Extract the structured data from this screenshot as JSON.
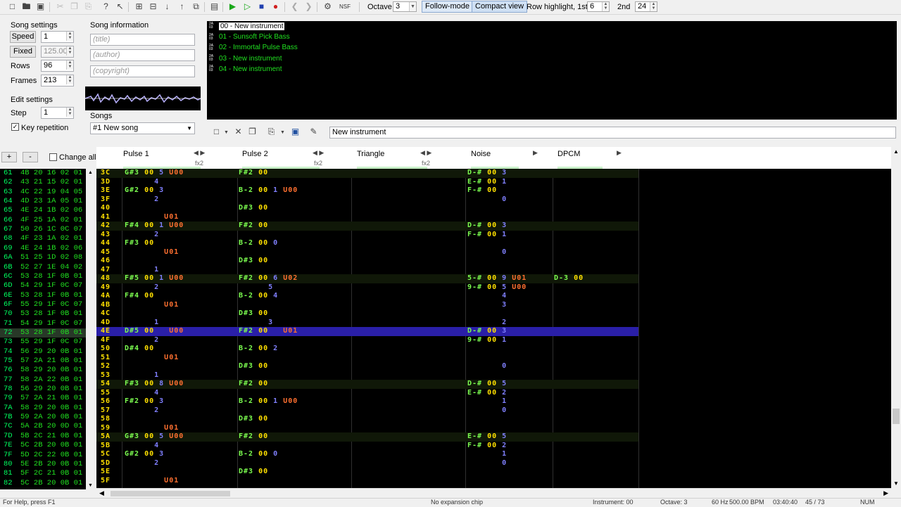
{
  "toolbar": {
    "octave_label": "Octave",
    "octave_value": "3",
    "follow_mode": "Follow-mode",
    "compact_view": "Compact view",
    "row_highlight_label": "Row highlight, 1st",
    "row_highlight_1st": "6",
    "second_label": "2nd",
    "row_highlight_2nd": "24"
  },
  "song_settings": {
    "title": "Song settings",
    "speed_label": "Speed",
    "speed_value": "1",
    "fixed_label": "Fixed",
    "tempo_value": "125.00",
    "rows_label": "Rows",
    "rows_value": "96",
    "frames_label": "Frames",
    "frames_value": "213"
  },
  "song_info": {
    "title": "Song information",
    "title_placeholder": "(title)",
    "author_placeholder": "(author)",
    "copyright_placeholder": "(copyright)"
  },
  "edit_settings": {
    "title": "Edit settings",
    "step_label": "Step",
    "step_value": "1",
    "key_repetition": "Key repetition"
  },
  "songs": {
    "label": "Songs",
    "selected": "#1 New song"
  },
  "instruments": [
    {
      "label": "00 - New instrument",
      "selected": true
    },
    {
      "label": "01 - Sunsoft Pick Bass",
      "selected": false
    },
    {
      "label": "02 - Immortal Pulse Bass",
      "selected": false
    },
    {
      "label": "03 - New instrument",
      "selected": false
    },
    {
      "label": "04 - New instrument",
      "selected": false
    }
  ],
  "instrument_name": "New instrument",
  "frame_controls": {
    "add": "+",
    "remove": "-",
    "change_all": "Change all"
  },
  "frames": [
    {
      "n": "61",
      "v": "4B 20 16 02 01"
    },
    {
      "n": "62",
      "v": "43 21 15 02 01"
    },
    {
      "n": "63",
      "v": "4C 22 19 04 05"
    },
    {
      "n": "64",
      "v": "4D 23 1A 05 01"
    },
    {
      "n": "65",
      "v": "4E 24 1B 02 06"
    },
    {
      "n": "66",
      "v": "4F 25 1A 02 01"
    },
    {
      "n": "67",
      "v": "50 26 1C 0C 07"
    },
    {
      "n": "68",
      "v": "4F 23 1A 02 01"
    },
    {
      "n": "69",
      "v": "4E 24 1B 02 06"
    },
    {
      "n": "6A",
      "v": "51 25 1D 02 08"
    },
    {
      "n": "6B",
      "v": "52 27 1E 04 02"
    },
    {
      "n": "6C",
      "v": "53 28 1F 0B 01"
    },
    {
      "n": "6D",
      "v": "54 29 1F 0C 07"
    },
    {
      "n": "6E",
      "v": "53 28 1F 0B 01"
    },
    {
      "n": "6F",
      "v": "55 29 1F 0C 07"
    },
    {
      "n": "70",
      "v": "53 28 1F 0B 01"
    },
    {
      "n": "71",
      "v": "54 29 1F 0C 07"
    },
    {
      "n": "72",
      "v": "53 28 1F 0B 01"
    },
    {
      "n": "73",
      "v": "55 29 1F 0C 07"
    },
    {
      "n": "74",
      "v": "56 29 20 0B 01"
    },
    {
      "n": "75",
      "v": "57 2A 21 0B 01"
    },
    {
      "n": "76",
      "v": "58 29 20 0B 01"
    },
    {
      "n": "77",
      "v": "58 2A 22 0B 01"
    },
    {
      "n": "78",
      "v": "56 29 20 0B 01"
    },
    {
      "n": "79",
      "v": "57 2A 21 0B 01"
    },
    {
      "n": "7A",
      "v": "58 29 20 0B 01"
    },
    {
      "n": "7B",
      "v": "59 2A 20 0B 01"
    },
    {
      "n": "7C",
      "v": "5A 2B 20 0D 01"
    },
    {
      "n": "7D",
      "v": "5B 2C 21 0B 01"
    },
    {
      "n": "7E",
      "v": "5C 2B 20 0B 01"
    },
    {
      "n": "7F",
      "v": "5D 2C 22 0B 01"
    },
    {
      "n": "80",
      "v": "5E 2B 20 0B 01"
    },
    {
      "n": "81",
      "v": "5F 2C 21 0B 01"
    },
    {
      "n": "82",
      "v": "5C 2B 20 0B 01"
    }
  ],
  "channels": [
    {
      "name": "Pulse 1",
      "fx": "fx2"
    },
    {
      "name": "Pulse 2",
      "fx": "fx2"
    },
    {
      "name": "Triangle",
      "fx": "fx2"
    },
    {
      "name": "Noise",
      "fx": ""
    },
    {
      "name": "DPCM",
      "fx": ""
    }
  ],
  "pattern_rows": [
    {
      "r": "3C",
      "p1": "G#3 00 5 U00",
      "p2": "F#2 00",
      "no": "D-# 00 3"
    },
    {
      "r": "3D",
      "p1": "      4",
      "p2": "",
      "no": "E-# 00 1"
    },
    {
      "r": "3E",
      "p1": "G#2 00 3",
      "p2": "B-2 00 1 U00",
      "no": "F-# 00"
    },
    {
      "r": "3F",
      "p1": "      2",
      "p2": "",
      "no": "       0"
    },
    {
      "r": "40",
      "p1": "",
      "p2": "D#3 00",
      "no": ""
    },
    {
      "r": "41",
      "p1": "        U01",
      "p2": "",
      "no": ""
    },
    {
      "r": "42",
      "p1": "F#4 00 1 U00",
      "p2": "F#2 00",
      "no": "D-# 00 3"
    },
    {
      "r": "43",
      "p1": "      2",
      "p2": "",
      "no": "F-# 00 1"
    },
    {
      "r": "44",
      "p1": "F#3 00",
      "p2": "B-2 00 0",
      "no": ""
    },
    {
      "r": "45",
      "p1": "        U01",
      "p2": "",
      "no": "       0"
    },
    {
      "r": "46",
      "p1": "",
      "p2": "D#3 00",
      "no": ""
    },
    {
      "r": "47",
      "p1": "      1",
      "p2": "",
      "no": ""
    },
    {
      "r": "48",
      "p1": "F#5 00 1 U00",
      "p2": "F#2 00 6 U02",
      "no": "5-# 00 9 U01",
      "dp": "D-3 00"
    },
    {
      "r": "49",
      "p1": "      2",
      "p2": "      5",
      "no": "9-# 00 5 U00"
    },
    {
      "r": "4A",
      "p1": "F#4 00",
      "p2": "B-2 00 4",
      "no": "       4"
    },
    {
      "r": "4B",
      "p1": "        U01",
      "p2": "",
      "no": "       3"
    },
    {
      "r": "4C",
      "p1": "",
      "p2": "D#3 00",
      "no": ""
    },
    {
      "r": "4D",
      "p1": "      1",
      "p2": "      3",
      "no": "       2"
    },
    {
      "r": "4E",
      "p1": "D#5 00   U00",
      "p2": "F#2 00   U01",
      "no": "D-# 00 3",
      "cur": true
    },
    {
      "r": "4F",
      "p1": "      2",
      "p2": "",
      "no": "9-# 00 1"
    },
    {
      "r": "50",
      "p1": "D#4 00",
      "p2": "B-2 00 2",
      "no": ""
    },
    {
      "r": "51",
      "p1": "        U01",
      "p2": "",
      "no": ""
    },
    {
      "r": "52",
      "p1": "",
      "p2": "D#3 00",
      "no": "       0"
    },
    {
      "r": "53",
      "p1": "      1",
      "p2": "",
      "no": ""
    },
    {
      "r": "54",
      "p1": "F#3 00 8 U00",
      "p2": "F#2 00",
      "no": "D-# 00 5"
    },
    {
      "r": "55",
      "p1": "      4",
      "p2": "",
      "no": "E-# 00 2"
    },
    {
      "r": "56",
      "p1": "F#2 00 3",
      "p2": "B-2 00 1 U00",
      "no": "       1"
    },
    {
      "r": "57",
      "p1": "      2",
      "p2": "",
      "no": "       0"
    },
    {
      "r": "58",
      "p1": "",
      "p2": "D#3 00",
      "no": ""
    },
    {
      "r": "59",
      "p1": "        U01",
      "p2": "",
      "no": ""
    },
    {
      "r": "5A",
      "p1": "G#3 00 5 U00",
      "p2": "F#2 00",
      "no": "E-# 00 5"
    },
    {
      "r": "5B",
      "p1": "      4",
      "p2": "",
      "no": "F-# 00 2"
    },
    {
      "r": "5C",
      "p1": "G#2 00 3",
      "p2": "B-2 00 0",
      "no": "       1"
    },
    {
      "r": "5D",
      "p1": "      2",
      "p2": "",
      "no": "       0"
    },
    {
      "r": "5E",
      "p1": "",
      "p2": "D#3 00",
      "no": ""
    },
    {
      "r": "5F",
      "p1": "        U01",
      "p2": "",
      "no": ""
    }
  ],
  "status": {
    "left": "For Help, press F1",
    "chip": "No expansion chip",
    "instrument": "Instrument: 00",
    "octave": "Octave: 3",
    "rate": "60 Hz",
    "bpm": "500.00 BPM",
    "time": "03:40:40",
    "pos": "45 / 73",
    "num": "NUM"
  },
  "colors": {
    "note": "#7cff50",
    "instrument": "#ffe000",
    "volume": "#8080ff",
    "effect": "#ff7030",
    "cursor": "#2a1fa8"
  }
}
